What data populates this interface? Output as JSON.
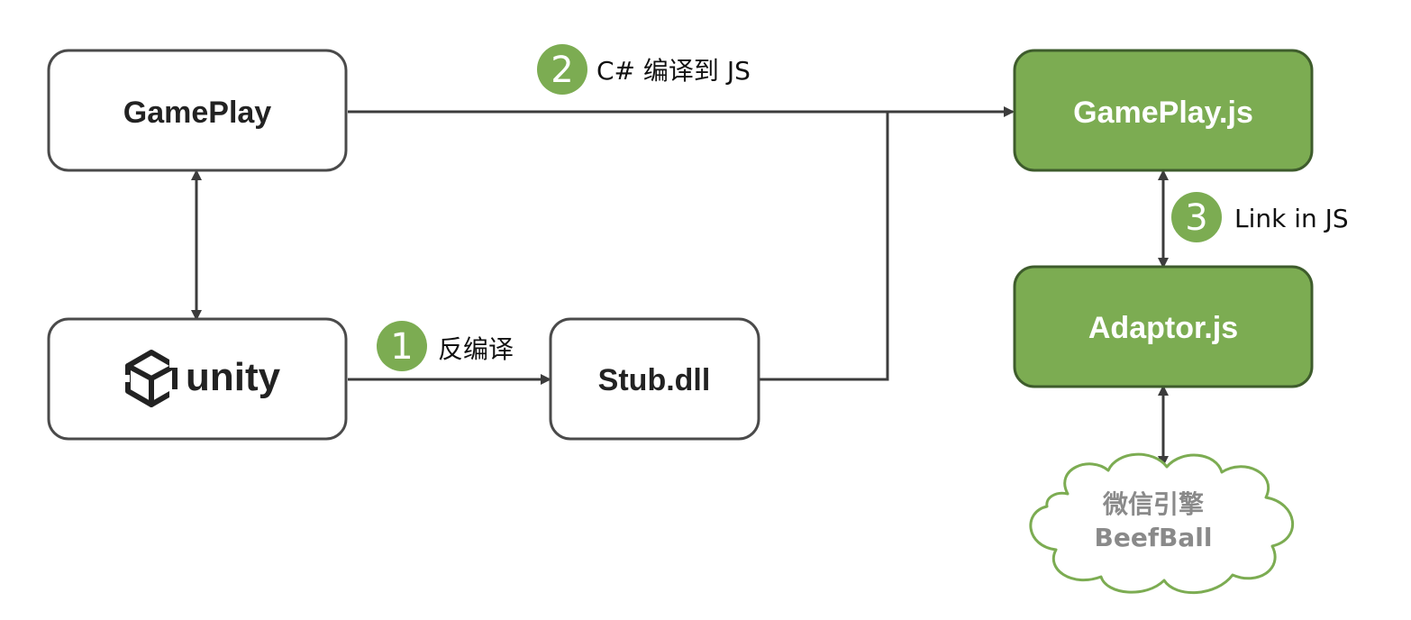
{
  "boxes": {
    "gameplay": "GamePlay",
    "unity": "unity",
    "stub": "Stub.dll",
    "gameplay_js": "GamePlay.js",
    "adaptor_js": "Adaptor.js"
  },
  "steps": [
    {
      "number": "1",
      "label": "反编译"
    },
    {
      "number": "2",
      "label": "C# 编译到 JS"
    },
    {
      "number": "3",
      "label": "Link in JS"
    }
  ],
  "cloud": {
    "line1": "微信引擎",
    "line2": "BeefBall"
  },
  "colors": {
    "accent_green": "#7cac52",
    "green_border": "#3e5c2c",
    "box_border": "#4a4a4a",
    "line": "#3c3c3c",
    "cloud_border": "#7cac52"
  },
  "icons": {
    "unity_logo": "unity-cube-logo-icon"
  }
}
